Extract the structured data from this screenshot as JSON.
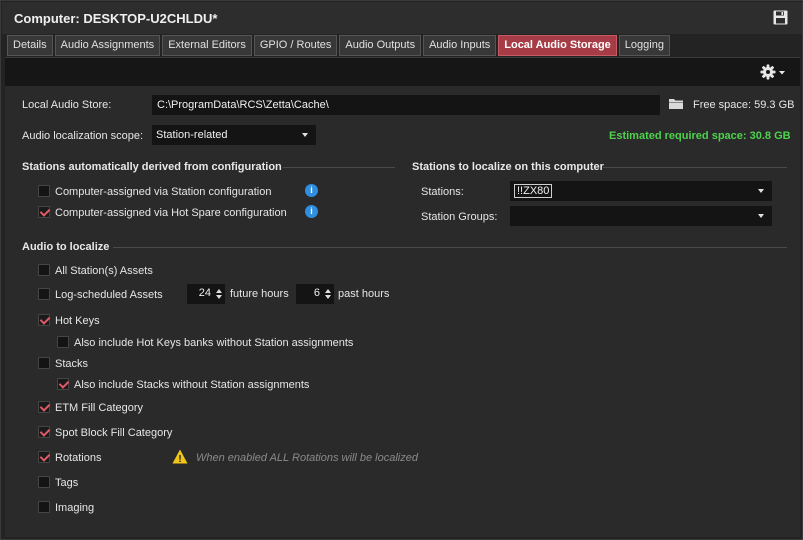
{
  "window": {
    "title": "Computer: DESKTOP-U2CHLDU*",
    "save_icon": "save-icon"
  },
  "tabs": [
    {
      "label": "Details",
      "active": false
    },
    {
      "label": "Audio Assignments",
      "active": false
    },
    {
      "label": "External Editors",
      "active": false
    },
    {
      "label": "GPIO / Routes",
      "active": false
    },
    {
      "label": "Audio Outputs",
      "active": false
    },
    {
      "label": "Audio Inputs",
      "active": false
    },
    {
      "label": "Local Audio Storage",
      "active": true
    },
    {
      "label": "Logging",
      "active": false
    }
  ],
  "toolbar": {
    "settings_icon": "gear-icon"
  },
  "store": {
    "label": "Local Audio Store:",
    "path": "C:\\ProgramData\\RCS\\Zetta\\Cache\\",
    "folder_icon": "folder-icon",
    "free_space": "Free space: 59.3 GB"
  },
  "scope": {
    "label": "Audio localization scope:",
    "value": "Station-related",
    "estimated": "Estimated required space: 30.8 GB"
  },
  "derived": {
    "title": "Stations automatically derived from configuration",
    "items": [
      {
        "label": "Computer-assigned via Station configuration",
        "checked": false
      },
      {
        "label": "Computer-assigned via Hot Spare configuration",
        "checked": true
      }
    ],
    "info_glyph": "i"
  },
  "localize_on": {
    "title": "Stations to localize on this computer",
    "stations_label": "Stations:",
    "stations_value": "!!ZX80",
    "groups_label": "Station Groups:",
    "groups_value": ""
  },
  "audio": {
    "title": "Audio to localize",
    "all_assets": {
      "label": "All Station(s) Assets",
      "checked": false
    },
    "log_scheduled": {
      "label": "Log-scheduled Assets",
      "checked": false,
      "future_value": "24",
      "future_label": "future hours",
      "past_value": "6",
      "past_label": "past hours"
    },
    "hot_keys": {
      "label": "Hot Keys",
      "checked": true
    },
    "hot_keys_sub": {
      "label": "Also include Hot Keys banks without Station assignments",
      "checked": false
    },
    "stacks": {
      "label": "Stacks",
      "checked": false
    },
    "stacks_sub": {
      "label": "Also include Stacks without Station assignments",
      "checked": true
    },
    "etm": {
      "label": "ETM Fill Category",
      "checked": true
    },
    "spot_block": {
      "label": "Spot Block Fill Category",
      "checked": true
    },
    "rotations": {
      "label": "Rotations",
      "checked": true
    },
    "rotations_warning": "When enabled ALL Rotations will be localized",
    "warning_glyph": "!",
    "tags": {
      "label": "Tags",
      "checked": false
    },
    "imaging": {
      "label": "Imaging",
      "checked": false
    }
  },
  "colors": {
    "accent_tab": "#a63c45",
    "check": "#e05a66",
    "info": "#2f8ee0",
    "estimate": "#4ed24e",
    "warning": "#f2c618"
  }
}
